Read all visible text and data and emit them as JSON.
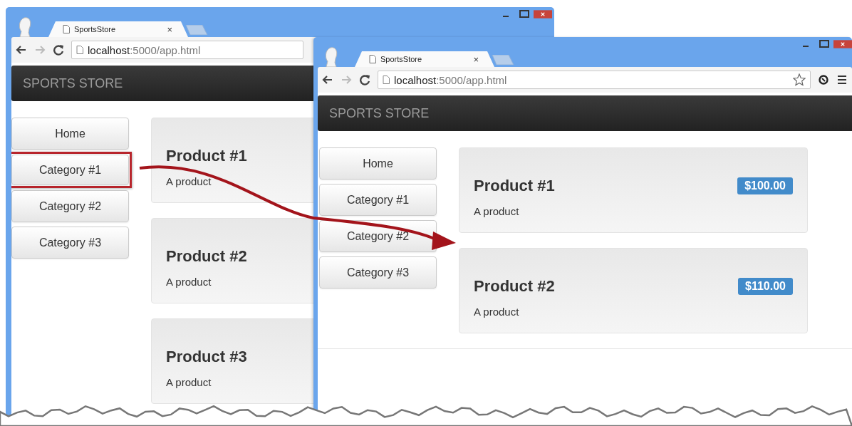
{
  "windows": [
    {
      "tab_title": "SportsStore",
      "tab_close": "×",
      "address": {
        "host": "localhost",
        "path": ":5000/app.html"
      },
      "brand": "SPORTS STORE",
      "categories": [
        {
          "label": "Home",
          "highlighted": false
        },
        {
          "label": "Category #1",
          "highlighted": true
        },
        {
          "label": "Category #2",
          "highlighted": false
        },
        {
          "label": "Category #3",
          "highlighted": false
        }
      ],
      "products": [
        {
          "name": "Product #1",
          "description": "A product"
        },
        {
          "name": "Product #2",
          "description": "A product"
        },
        {
          "name": "Product #3",
          "description": "A product"
        }
      ]
    },
    {
      "tab_title": "SportsStore",
      "tab_close": "×",
      "address": {
        "host": "localhost",
        "path": ":5000/app.html"
      },
      "toolbar_icons": true,
      "brand": "SPORTS STORE",
      "categories": [
        {
          "label": "Home",
          "highlighted": false
        },
        {
          "label": "Category #1",
          "highlighted": false
        },
        {
          "label": "Category #2",
          "highlighted": false
        },
        {
          "label": "Category #3",
          "highlighted": false
        }
      ],
      "products": [
        {
          "name": "Product #1",
          "description": "A product",
          "price": "$100.00"
        },
        {
          "name": "Product #2",
          "description": "A product",
          "price": "$110.00"
        }
      ]
    }
  ]
}
